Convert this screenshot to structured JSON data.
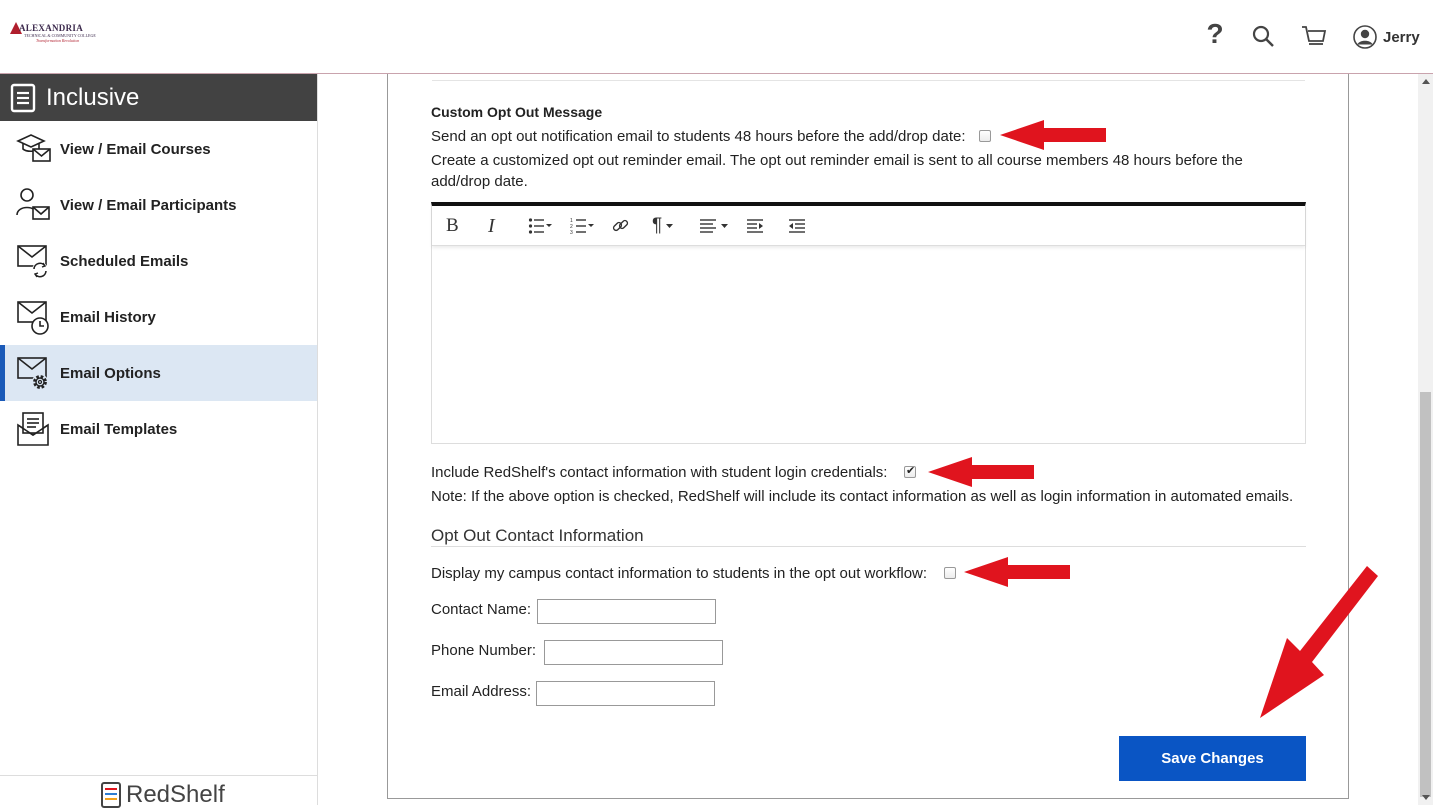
{
  "header": {
    "logo": {
      "name": "ALEXANDRIA",
      "sub": "TECHNICAL & COMMUNITY COLLEGE",
      "tagline": "Transformation Revolution"
    },
    "icons": [
      "help-icon",
      "search-icon",
      "cart-icon",
      "user-icon"
    ],
    "help_glyph": "?",
    "user_name": "Jerry"
  },
  "sidebar": {
    "title": "Inclusive",
    "items": [
      {
        "label": "View / Email Courses",
        "icon": "graduation-mail-icon"
      },
      {
        "label": "View / Email Participants",
        "icon": "person-mail-icon"
      },
      {
        "label": "Scheduled Emails",
        "icon": "mail-refresh-icon"
      },
      {
        "label": "Email History",
        "icon": "mail-clock-icon"
      },
      {
        "label": "Email Options",
        "icon": "mail-gear-icon",
        "active": true
      },
      {
        "label": "Email Templates",
        "icon": "mail-template-icon"
      }
    ],
    "footer_logo": "RedShelf"
  },
  "main": {
    "custom_optout": {
      "heading": "Custom Opt Out Message",
      "notify_label": "Send an opt out notification email to students 48 hours before the add/drop date:",
      "notify_checked": false,
      "description_line1": "Create a customized opt out reminder email. The opt out reminder email is sent to all course members 48 hours before the",
      "description_line2": "add/drop date."
    },
    "editor": {
      "toolbar": [
        "bold-icon",
        "italic-icon",
        "bulleted-list-icon",
        "numbered-list-icon",
        "link-icon",
        "paragraph-icon",
        "align-icon",
        "indent-icon",
        "outdent-icon"
      ],
      "bold_glyph": "B",
      "italic_glyph": "I",
      "paragraph_glyph": "¶",
      "content": ""
    },
    "redshelf_contact": {
      "label": "Include RedShelf's contact information with student login credentials:",
      "checked": true,
      "note": "Note: If the above option is checked, RedShelf will include its contact information as well as login information in automated emails."
    },
    "optout_contact": {
      "heading": "Opt Out Contact Information",
      "display_label": "Display my campus contact information to students in the opt out workflow:",
      "display_checked": false,
      "contact_name_label": "Contact Name:",
      "contact_name_value": "",
      "phone_label": "Phone Number:",
      "phone_value": "",
      "email_label": "Email Address:",
      "email_value": ""
    },
    "save_label": "Save Changes"
  },
  "colors": {
    "accent": "#0a55c4",
    "sidebar_header": "#424242",
    "active_nav": "#dce7f3",
    "annotation_arrow": "#e0141e"
  }
}
